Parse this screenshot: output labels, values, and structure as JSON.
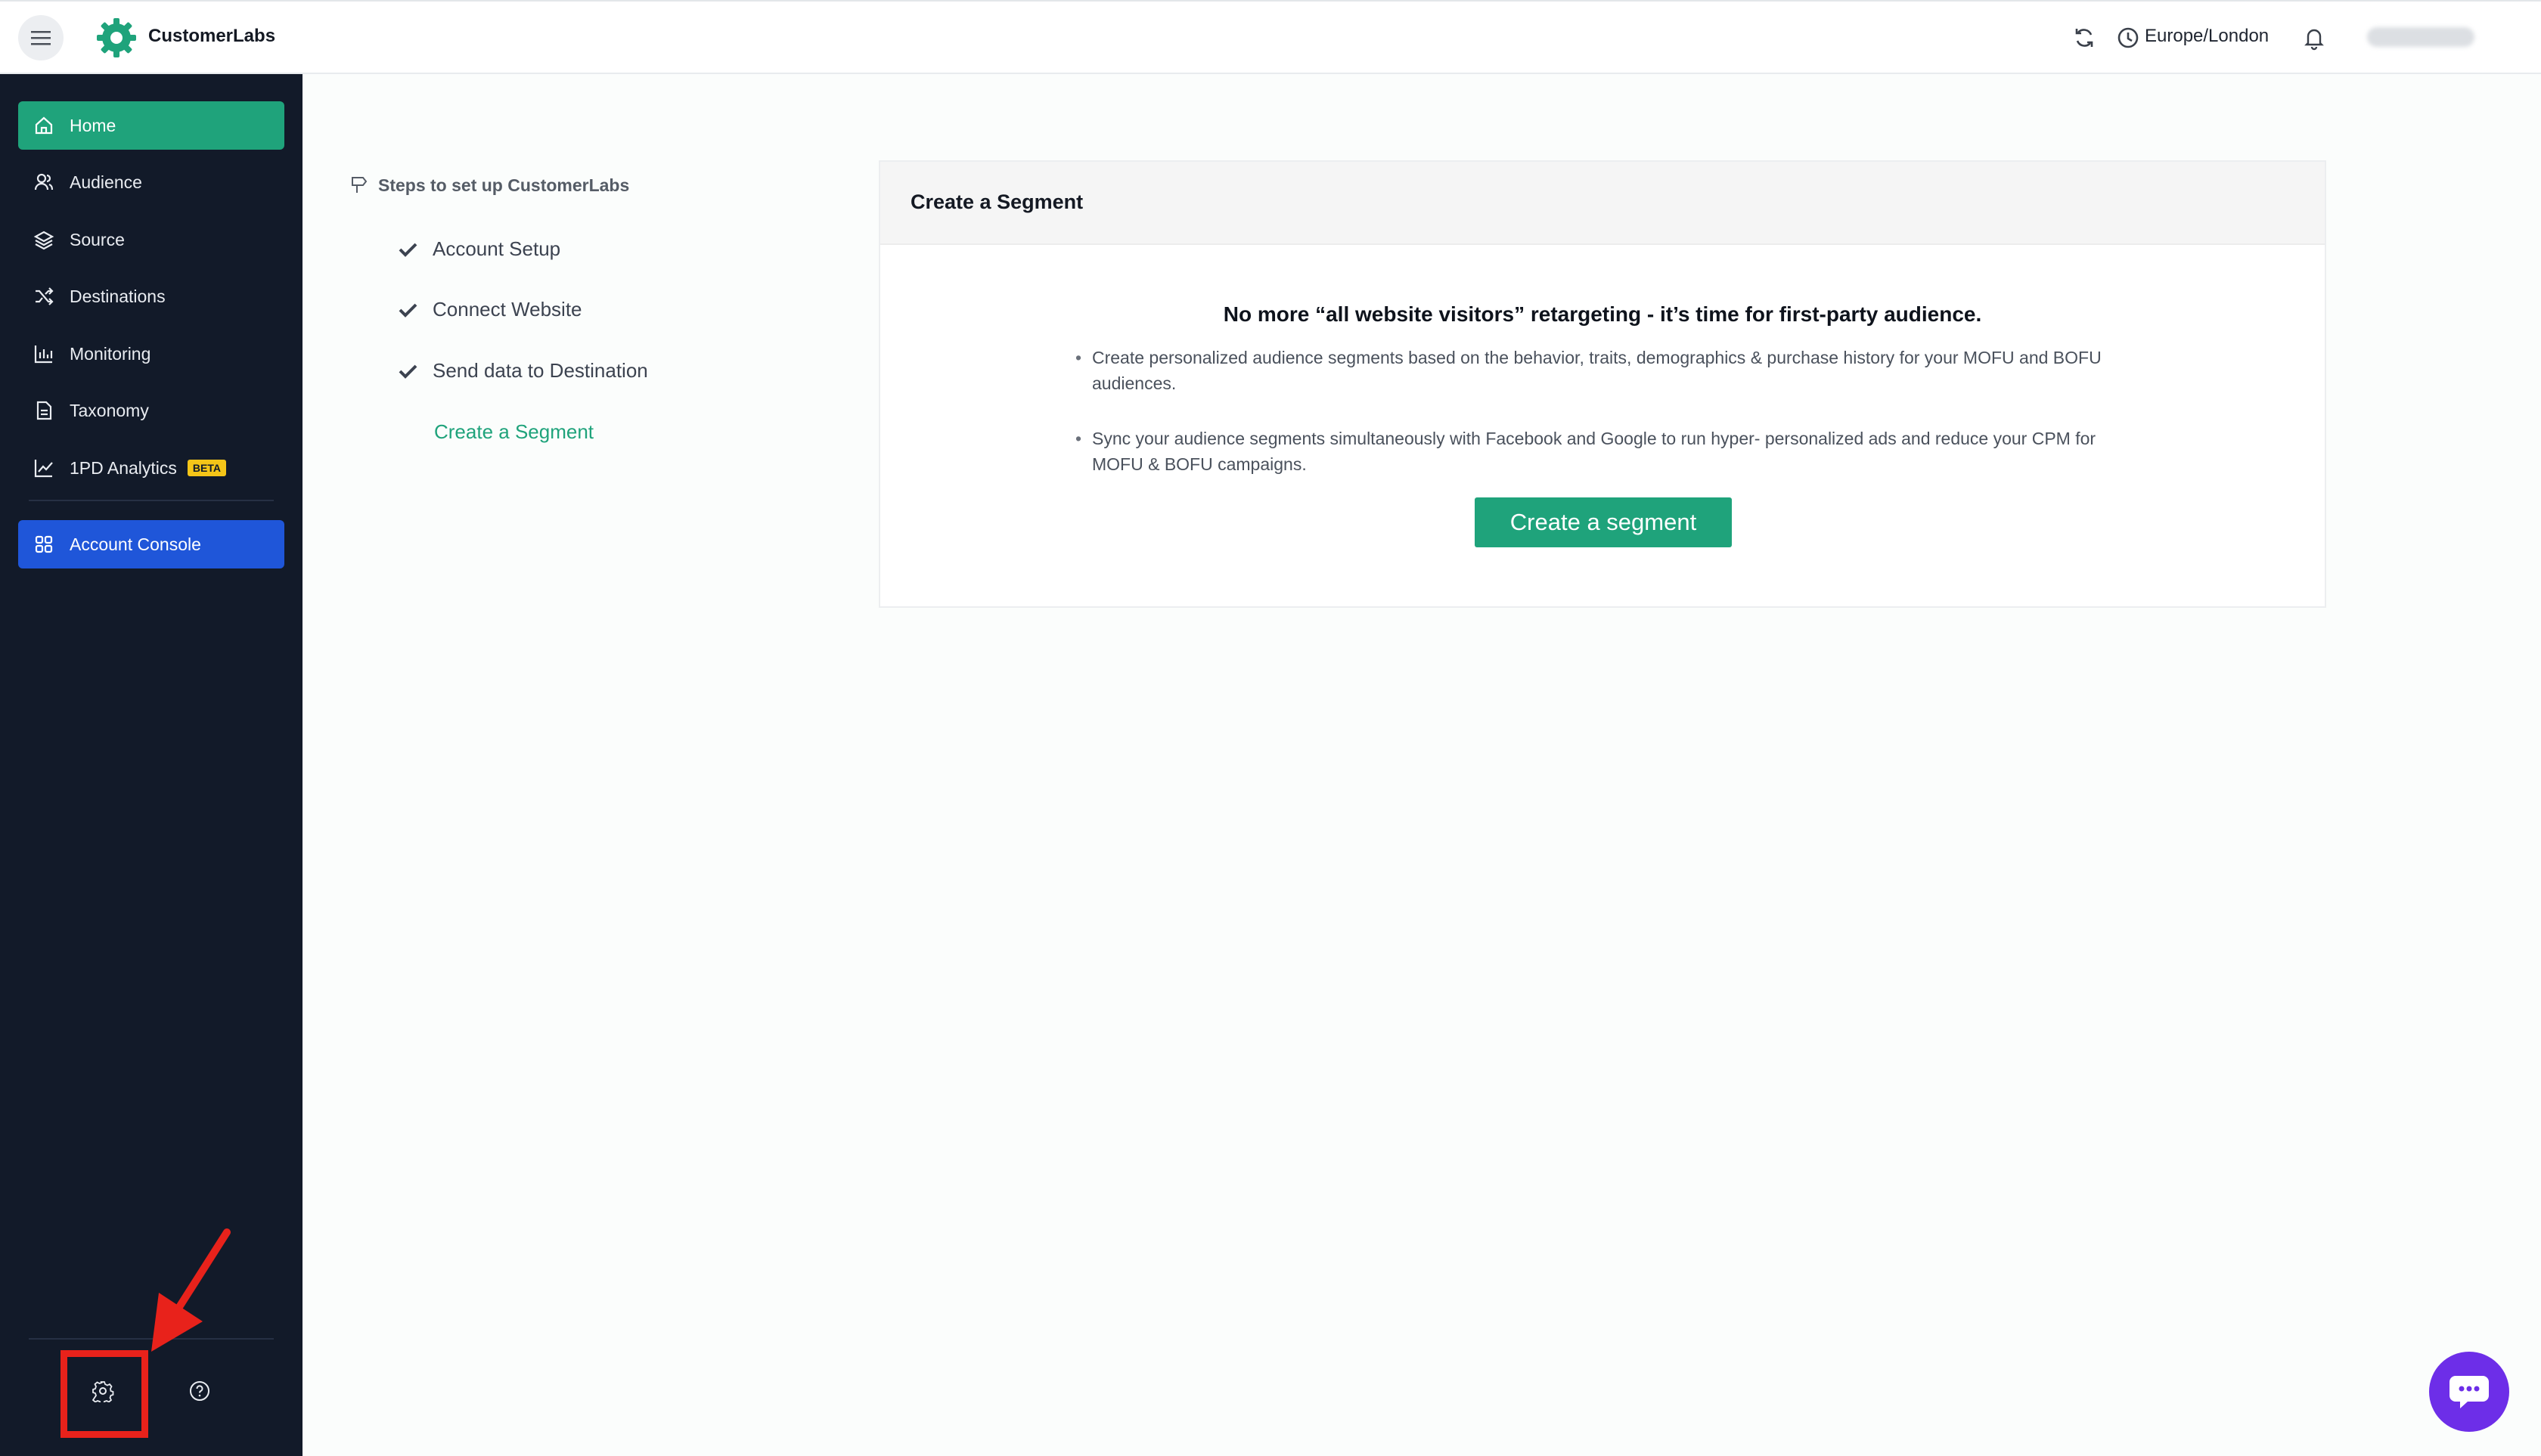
{
  "app": {
    "brand": "CustomerLabs",
    "timezone": "Europe/London",
    "accent_color": "#1fa37b",
    "console_color": "#1f56d9"
  },
  "sidebar": {
    "items": [
      {
        "label": "Home",
        "icon": "home-icon",
        "active": true
      },
      {
        "label": "Audience",
        "icon": "users-icon"
      },
      {
        "label": "Source",
        "icon": "layers-icon"
      },
      {
        "label": "Destinations",
        "icon": "shuffle-icon"
      },
      {
        "label": "Monitoring",
        "icon": "bar-chart-icon"
      },
      {
        "label": "Taxonomy",
        "icon": "document-icon"
      },
      {
        "label": "1PD Analytics",
        "icon": "line-chart-icon",
        "badge": "BETA"
      }
    ],
    "console": {
      "label": "Account Console",
      "icon": "grid-icon"
    }
  },
  "steps": {
    "title": "Steps to set up CustomerLabs",
    "items": [
      {
        "label": "Account Setup",
        "done": true
      },
      {
        "label": "Connect Website",
        "done": true
      },
      {
        "label": "Send data to Destination",
        "done": true
      },
      {
        "label": "Create a Segment",
        "done": false
      }
    ]
  },
  "card": {
    "title": "Create a Segment",
    "heading": "No more “all website visitors” retargeting - it’s time for first-party audience.",
    "bullets": [
      "Create personalized audience segments based on the behavior, traits, demographics & purchase history for your MOFU and BOFU audiences.",
      "Sync your audience segments simultaneously with Facebook and Google to run hyper- personalized ads and reduce your CPM for MOFU & BOFU campaigns."
    ],
    "button": "Create a segment"
  }
}
